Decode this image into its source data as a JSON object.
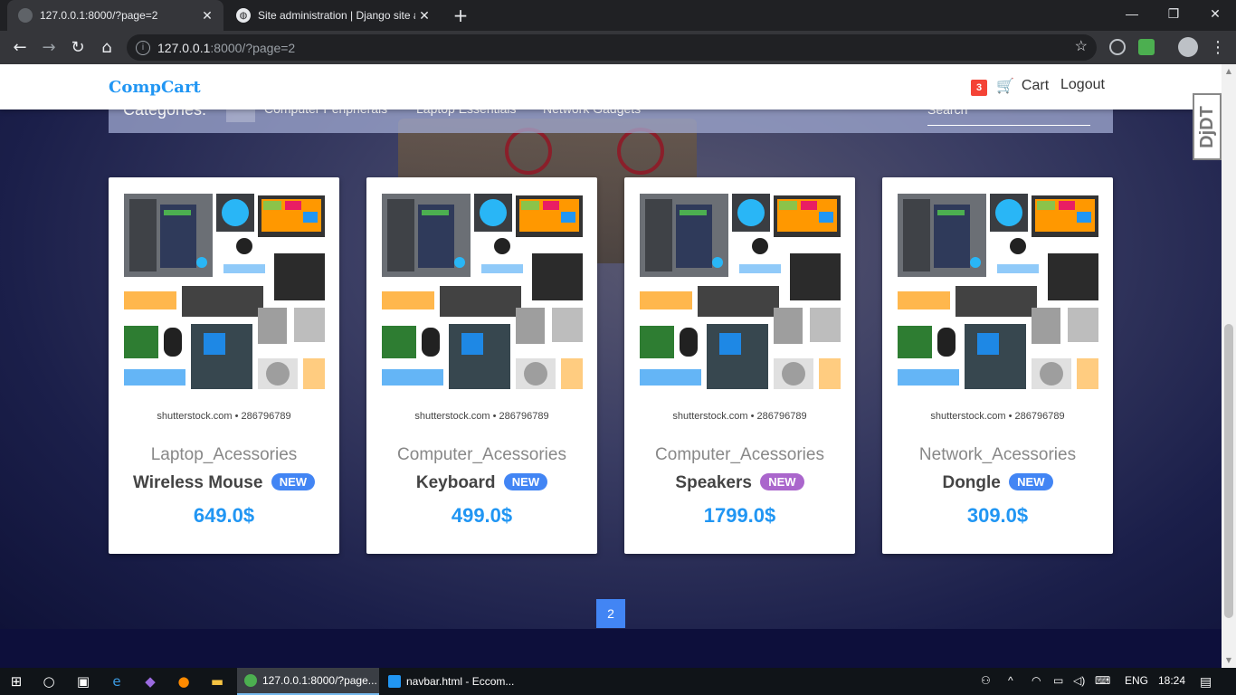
{
  "browser": {
    "tabs": [
      {
        "title": "127.0.0.1:8000/?page=2"
      },
      {
        "title": "Site administration | Django site a"
      }
    ],
    "url_host": "127.0.0.1",
    "url_path": ":8000/?page=2"
  },
  "navbar": {
    "brand": "CompCart",
    "cart_count": "3",
    "cart_label": "Cart",
    "logout_label": "Logout"
  },
  "djdt": "DjDT",
  "categories": {
    "label": "Categories:",
    "items": [
      "All",
      "Computer Peripherals",
      "Laptop Essentials",
      "Network Gadgets"
    ],
    "search_placeholder": "Search"
  },
  "products": [
    {
      "credit": "shutterstock.com • 286796789",
      "category": "Laptop_Acessories",
      "name": "Wireless Mouse",
      "badge": "NEW",
      "badge_color": "#4285f4",
      "price": "649.0$"
    },
    {
      "credit": "shutterstock.com • 286796789",
      "category": "Computer_Acessories",
      "name": "Keyboard",
      "badge": "NEW",
      "badge_color": "#4285f4",
      "price": "499.0$"
    },
    {
      "credit": "shutterstock.com • 286796789",
      "category": "Computer_Acessories",
      "name": "Speakers",
      "badge": "NEW",
      "badge_color": "#aa66cc",
      "price": "1799.0$"
    },
    {
      "credit": "shutterstock.com • 286796789",
      "category": "Network_Acessories",
      "name": "Dongle",
      "badge": "NEW",
      "badge_color": "#4285f4",
      "price": "309.0$"
    }
  ],
  "pagination": {
    "current": "2"
  },
  "taskbar": {
    "apps": [
      {
        "label": "127.0.0.1:8000/?page..."
      },
      {
        "label": "navbar.html - Eccom..."
      }
    ],
    "language": "ENG",
    "time": "18:24"
  },
  "colors": {
    "accent": "#2196f3",
    "badge_red": "#f44336"
  }
}
